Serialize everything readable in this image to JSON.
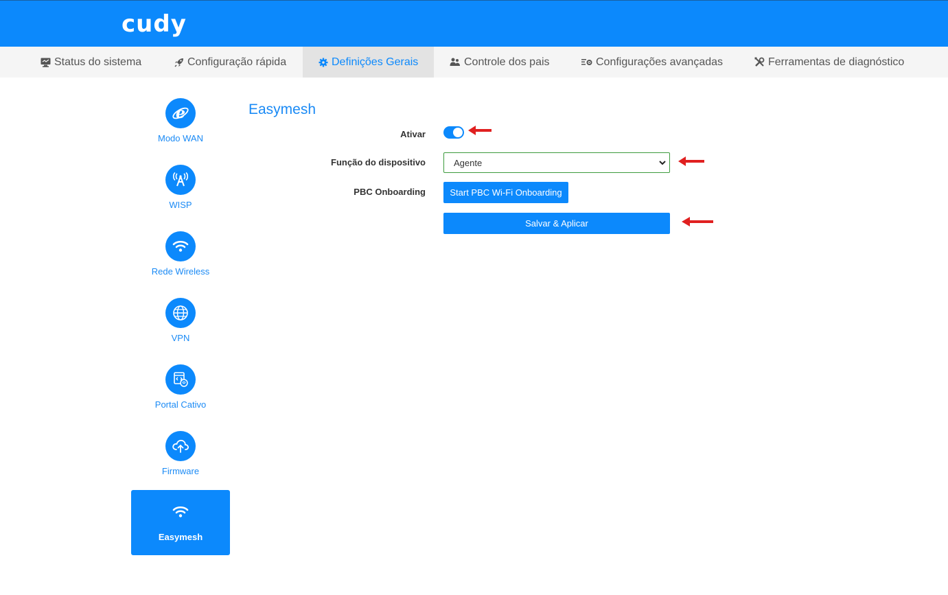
{
  "brand": {
    "logo": "cudy"
  },
  "nav": {
    "items": [
      {
        "label": "Status do sistema",
        "icon": "monitor-icon"
      },
      {
        "label": "Configuração rápida",
        "icon": "rocket-icon"
      },
      {
        "label": "Definições Gerais",
        "icon": "gear-icon",
        "active": true
      },
      {
        "label": "Controle dos pais",
        "icon": "users-icon"
      },
      {
        "label": "Configurações avançadas",
        "icon": "advanced-settings-icon"
      },
      {
        "label": "Ferramentas de diagnóstico",
        "icon": "tools-icon"
      }
    ]
  },
  "sidebar": {
    "items": [
      {
        "label": "Modo WAN",
        "icon": "internet-explorer-icon"
      },
      {
        "label": "WISP",
        "icon": "antenna-icon"
      },
      {
        "label": "Rede Wireless",
        "icon": "wifi-icon"
      },
      {
        "label": "VPN",
        "icon": "globe-icon"
      },
      {
        "label": "Portal Cativo",
        "icon": "portal-icon"
      },
      {
        "label": "Firmware",
        "icon": "cloud-upload-icon"
      },
      {
        "label": "Easymesh",
        "icon": "wifi-icon",
        "active": true
      }
    ]
  },
  "main": {
    "title": "Easymesh",
    "enable_label": "Ativar",
    "enable_value": true,
    "device_role_label": "Função do dispositivo",
    "device_role_value": "Agente",
    "pbc_label": "PBC Onboarding",
    "pbc_button": "Start PBC Wi-Fi Onboarding",
    "save_button": "Salvar & Aplicar"
  },
  "colors": {
    "primary": "#0c89fc",
    "nav_bg": "#f5f5f5",
    "arrow": "#e02020",
    "select_border": "#3c9a3c"
  }
}
